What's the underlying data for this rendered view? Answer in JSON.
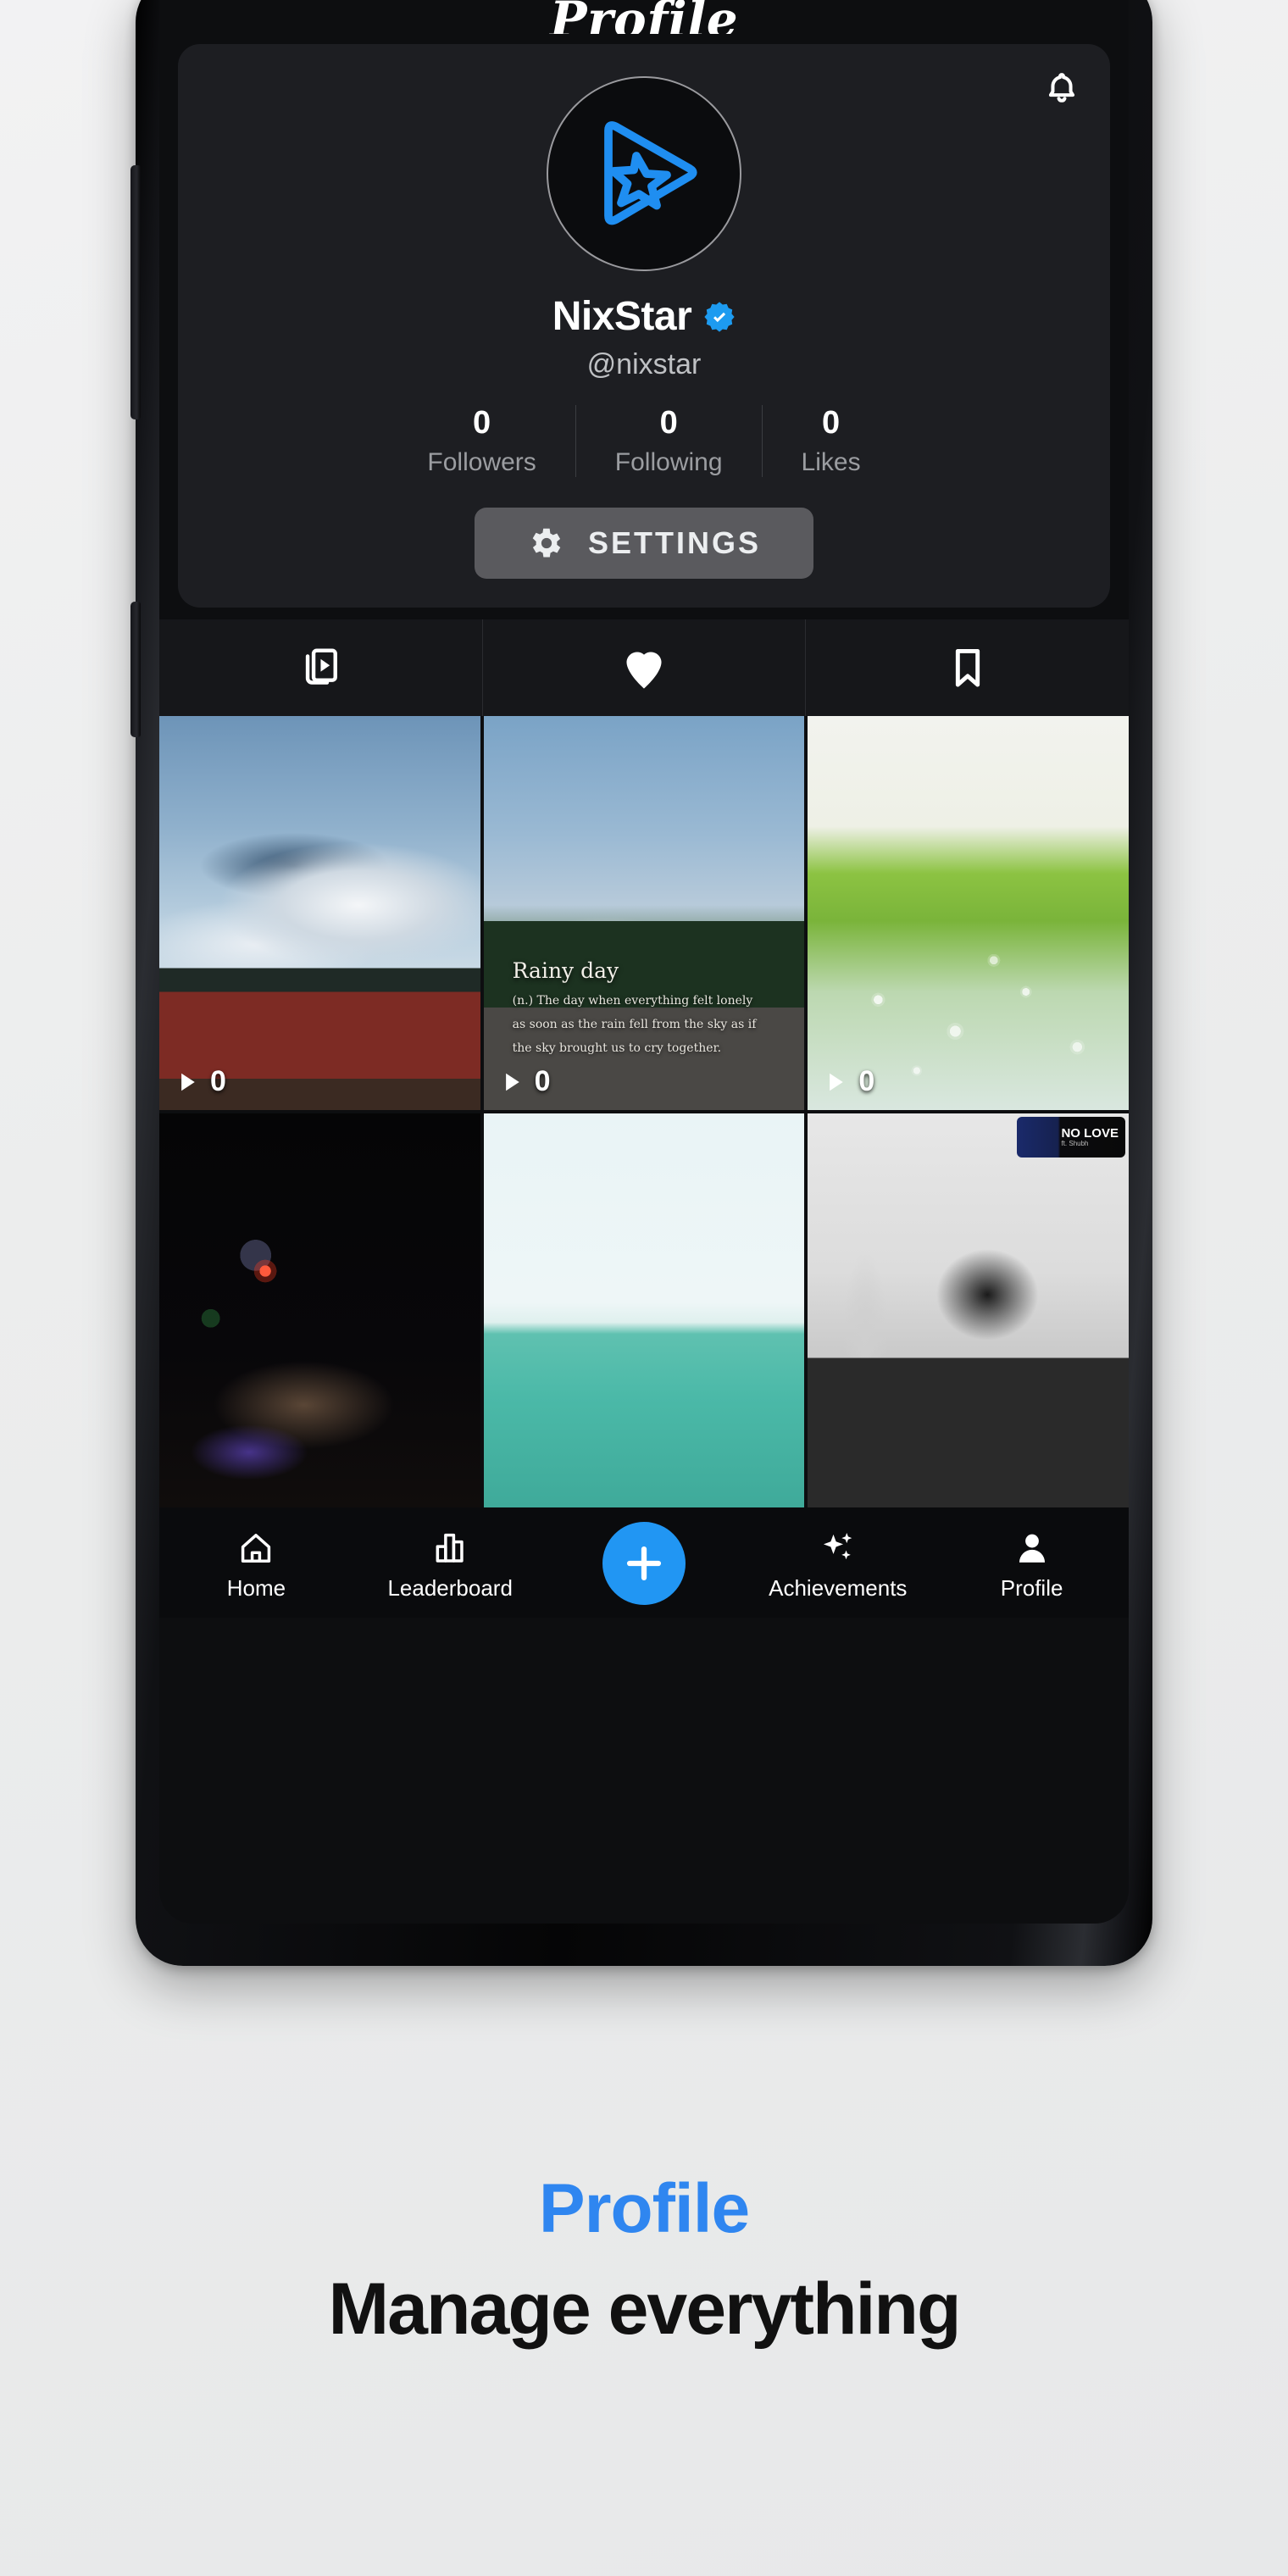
{
  "app": {
    "header_title": "Profile"
  },
  "profile": {
    "notification_icon": "bell-icon",
    "avatar_icon": "play-star-logo",
    "display_name": "NixStar",
    "verified_icon": "verified-badge-icon",
    "handle": "@nixstar",
    "stats": [
      {
        "value": "0",
        "label": "Followers"
      },
      {
        "value": "0",
        "label": "Following"
      },
      {
        "value": "0",
        "label": "Likes"
      }
    ],
    "settings_button": {
      "icon": "gear-icon",
      "label": "SETTINGS"
    }
  },
  "tabs": [
    {
      "name": "videos",
      "icon": "video-library-icon",
      "active": true
    },
    {
      "name": "liked",
      "icon": "heart-icon",
      "active": false
    },
    {
      "name": "saved",
      "icon": "bookmark-icon",
      "active": false
    }
  ],
  "grid": [
    {
      "name": "clouds-over-town",
      "views": "0",
      "overlay_title": "",
      "overlay_body": "",
      "sticker": null
    },
    {
      "name": "rainy-day-street",
      "views": "0",
      "overlay_title": "Rainy day",
      "overlay_body": "(n.) The day when everything felt lonely as soon as the rain fell from the sky as if the sky brought us to cry together.",
      "sticker": null
    },
    {
      "name": "green-field-bokeh",
      "views": "0",
      "overlay_title": "",
      "overlay_body": "",
      "sticker": null
    },
    {
      "name": "night-lights",
      "views": "",
      "overlay_title": "",
      "overlay_body": "",
      "sticker": null
    },
    {
      "name": "sea-horizon",
      "views": "",
      "overlay_title": "",
      "overlay_body": "",
      "sticker": null
    },
    {
      "name": "boy-on-railway-bw",
      "views": "",
      "overlay_title": "",
      "overlay_body": "",
      "sticker": {
        "title": "NO LOVE",
        "subtitle": "ft. Shubh"
      }
    }
  ],
  "bottom_nav": [
    {
      "name": "home",
      "icon": "home-icon",
      "label": "Home"
    },
    {
      "name": "leaderboard",
      "icon": "bar-chart-icon",
      "label": "Leaderboard"
    },
    {
      "name": "create",
      "icon": "plus-icon",
      "label": ""
    },
    {
      "name": "achievements",
      "icon": "sparkles-icon",
      "label": "Achievements"
    },
    {
      "name": "profile",
      "icon": "person-icon",
      "label": "Profile"
    }
  ],
  "caption": {
    "title": "Profile",
    "subtitle": "Manage everything"
  },
  "colors": {
    "accent": "#2196f3",
    "caption_title": "#2f86f0",
    "card_bg": "#1d1e22",
    "screen_bg": "#0d0e10"
  }
}
